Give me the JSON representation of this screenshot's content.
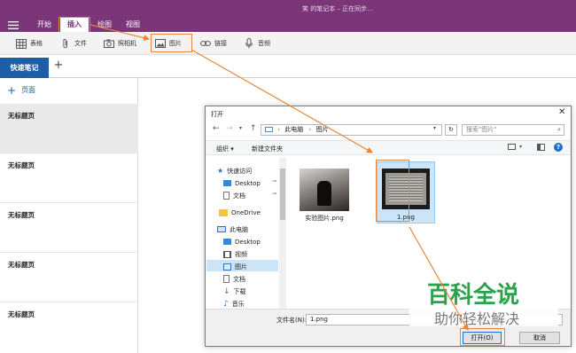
{
  "window": {
    "title": "笑 的笔记本 – 正在同步..."
  },
  "ribbon": {
    "tabs": [
      {
        "label": "开始"
      },
      {
        "label": "插入",
        "active": true
      },
      {
        "label": "绘图"
      },
      {
        "label": "视图"
      }
    ]
  },
  "toolbar": {
    "items": [
      {
        "label": "表格",
        "icon": "table-icon"
      },
      {
        "label": "文件",
        "icon": "paperclip-icon"
      },
      {
        "label": "照相机",
        "icon": "camera-icon"
      },
      {
        "label": "图片",
        "icon": "picture-icon"
      },
      {
        "label": "链接",
        "icon": "link-icon"
      },
      {
        "label": "音频",
        "icon": "microphone-icon"
      }
    ]
  },
  "notebook": {
    "section_tab": "快速笔记",
    "add_page_label": "页面",
    "pages": [
      "无标题页",
      "无标题页",
      "无标题页",
      "无标题页",
      "无标题页"
    ]
  },
  "dialog": {
    "title": "打开",
    "breadcrumb": [
      "此电脑",
      "图片"
    ],
    "search_placeholder": "搜索\"图片\"",
    "organize_label": "组织 ▾",
    "new_folder_label": "新建文件夹",
    "sidebar": [
      {
        "label": "快速访问",
        "icon": "star-icon"
      },
      {
        "label": "Desktop",
        "icon": "desktop-icon",
        "pinned": true
      },
      {
        "label": "文档",
        "icon": "document-icon",
        "pinned": true
      },
      {
        "label": "OneDrive",
        "icon": "folder-icon"
      },
      {
        "label": "此电脑",
        "icon": "computer-icon"
      },
      {
        "label": "Desktop",
        "icon": "desktop-icon"
      },
      {
        "label": "视频",
        "icon": "video-icon"
      },
      {
        "label": "图片",
        "icon": "picture-icon",
        "selected": true
      },
      {
        "label": "文档",
        "icon": "document-icon"
      },
      {
        "label": "下载",
        "icon": "download-icon"
      },
      {
        "label": "音乐",
        "icon": "music-icon"
      }
    ],
    "files": [
      {
        "name": "实验图片.png"
      },
      {
        "name": "1.png",
        "selected": true
      }
    ],
    "filename_label": "文件名(N):",
    "filename_value": "1.png",
    "open_button": "打开(O)",
    "cancel_button": "取消"
  },
  "watermark": {
    "line1": "百科全说",
    "line2": "助你轻松解决"
  },
  "colors": {
    "brand_purple": "#7a3679",
    "section_blue": "#1d5fa6",
    "highlight_orange": "#e8863a"
  }
}
